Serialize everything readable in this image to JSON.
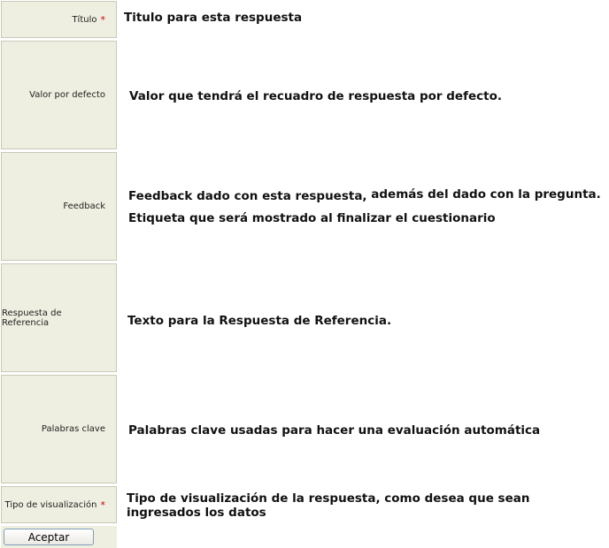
{
  "fields": {
    "titulo": {
      "label": "Título",
      "required_mark": "*",
      "description": "Titulo para esta respuesta"
    },
    "valor": {
      "label": "Valor por defecto",
      "description": "Valor que tendrá el recuadro de respuesta por defecto."
    },
    "feedback": {
      "label": "Feedback",
      "description_line1_a": "Feedback dado con esta respuesta,",
      "description_line1_b": "además del dado con la pregunta.",
      "description_line2": "Etiqueta que será mostrado al finalizar el cuestionario"
    },
    "referencia": {
      "label": "Respuesta de Referencia",
      "description": "Texto para la Respuesta de Referencia."
    },
    "palabras": {
      "label": "Palabras clave",
      "description": "Palabras clave usadas para hacer una evaluación automática"
    },
    "tipo": {
      "label": "Tipo de visualización",
      "required_mark": "*",
      "description": "Tipo de visualización de la respuesta, como desea que sean ingresados los datos"
    }
  },
  "actions": {
    "accept_label": "Aceptar"
  },
  "colors": {
    "label_background": "#efefe1",
    "label_border": "#c9c9b8",
    "required_mark": "#cc0000"
  }
}
